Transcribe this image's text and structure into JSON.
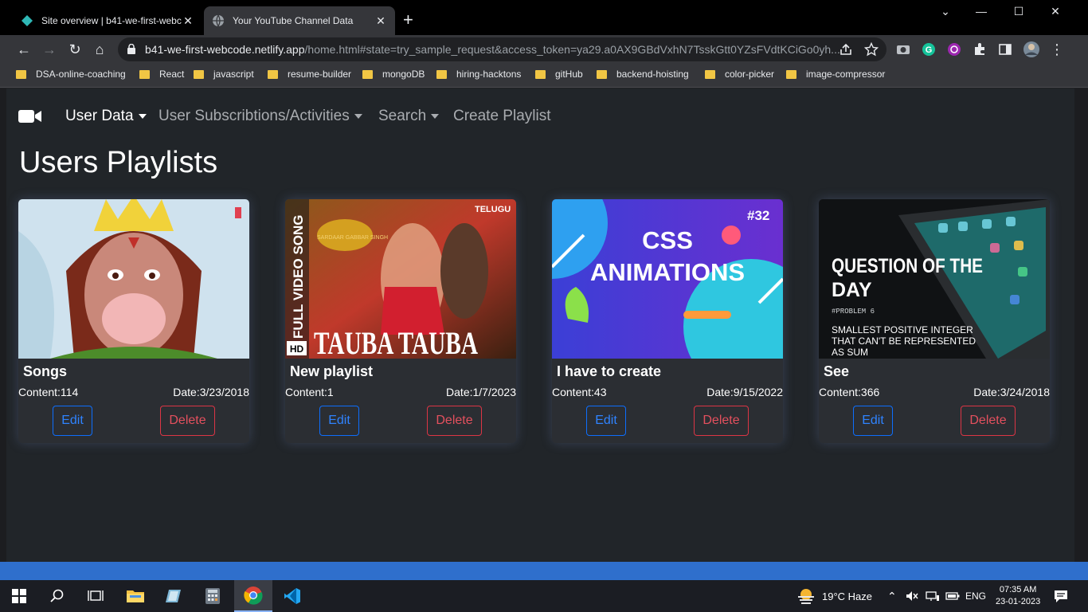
{
  "browser": {
    "tabs": [
      {
        "title": "Site overview | b41-we-first-webc",
        "active": false
      },
      {
        "title": "Your YouTube Channel Data",
        "active": true
      }
    ],
    "url_host": "b41-we-first-webcode.netlify.app",
    "url_path": "/home.html#state=try_sample_request&access_token=ya29.a0AX9GBdVxhN7TsskGtt0YZsFVdtKCiGo0yh...",
    "bookmarks": [
      "DSA-online-coaching",
      "React",
      "javascript",
      "resume-builder",
      "mongoDB",
      "hiring-hacktons",
      "gitHub",
      "backend-hoisting",
      "color-picker",
      "image-compressor"
    ]
  },
  "nav": {
    "brand_icon": "video-camera-icon",
    "items": [
      {
        "label": "User Data",
        "dropdown": true,
        "active": true
      },
      {
        "label": "User Subscribtions/Activities",
        "dropdown": true,
        "active": false
      },
      {
        "label": "Search",
        "dropdown": true,
        "active": false
      },
      {
        "label": "Create Playlist",
        "dropdown": false,
        "active": false
      }
    ]
  },
  "page_title": "Users Playlists",
  "playlists": [
    {
      "name": "Songs",
      "content": "Content:114",
      "date": "Date:3/23/2018",
      "edit_label": "Edit",
      "delete_label": "Delete"
    },
    {
      "name": "New playlist",
      "content": "Content:1",
      "date": "Date:1/7/2023",
      "edit_label": "Edit",
      "delete_label": "Delete",
      "thumb_text": {
        "side": "FULL VIDEO SONG",
        "corner": "TELUGU",
        "main": "TAUBA TAUBA",
        "badge": "HD",
        "logo": "SARDAAR GABBAR SINGH"
      }
    },
    {
      "name": "I have to create",
      "content": "Content:43",
      "date": "Date:9/15/2022",
      "edit_label": "Edit",
      "delete_label": "Delete",
      "thumb_text": {
        "number": "#32",
        "line1": "CSS",
        "line2": "ANIMATIONS"
      }
    },
    {
      "name": "See",
      "content": "Content:366",
      "date": "Date:3/24/2018",
      "edit_label": "Edit",
      "delete_label": "Delete",
      "thumb_text": {
        "title1": "QUESTION OF THE",
        "title2": "DAY",
        "sub": "#PROBLEM 6",
        "desc1": "SMALLEST POSITIVE INTEGER",
        "desc2": "THAT CAN'T BE REPRESENTED",
        "desc3": "AS SUM"
      }
    }
  ],
  "taskbar": {
    "weather": "19°C  Haze",
    "lang": "ENG",
    "time": "07:35 AM",
    "date": "23-01-2023"
  },
  "colors": {
    "primary": "#0d6efd",
    "danger": "#dc3545",
    "page_bg": "#212529",
    "card_bg": "#2b2e33"
  }
}
